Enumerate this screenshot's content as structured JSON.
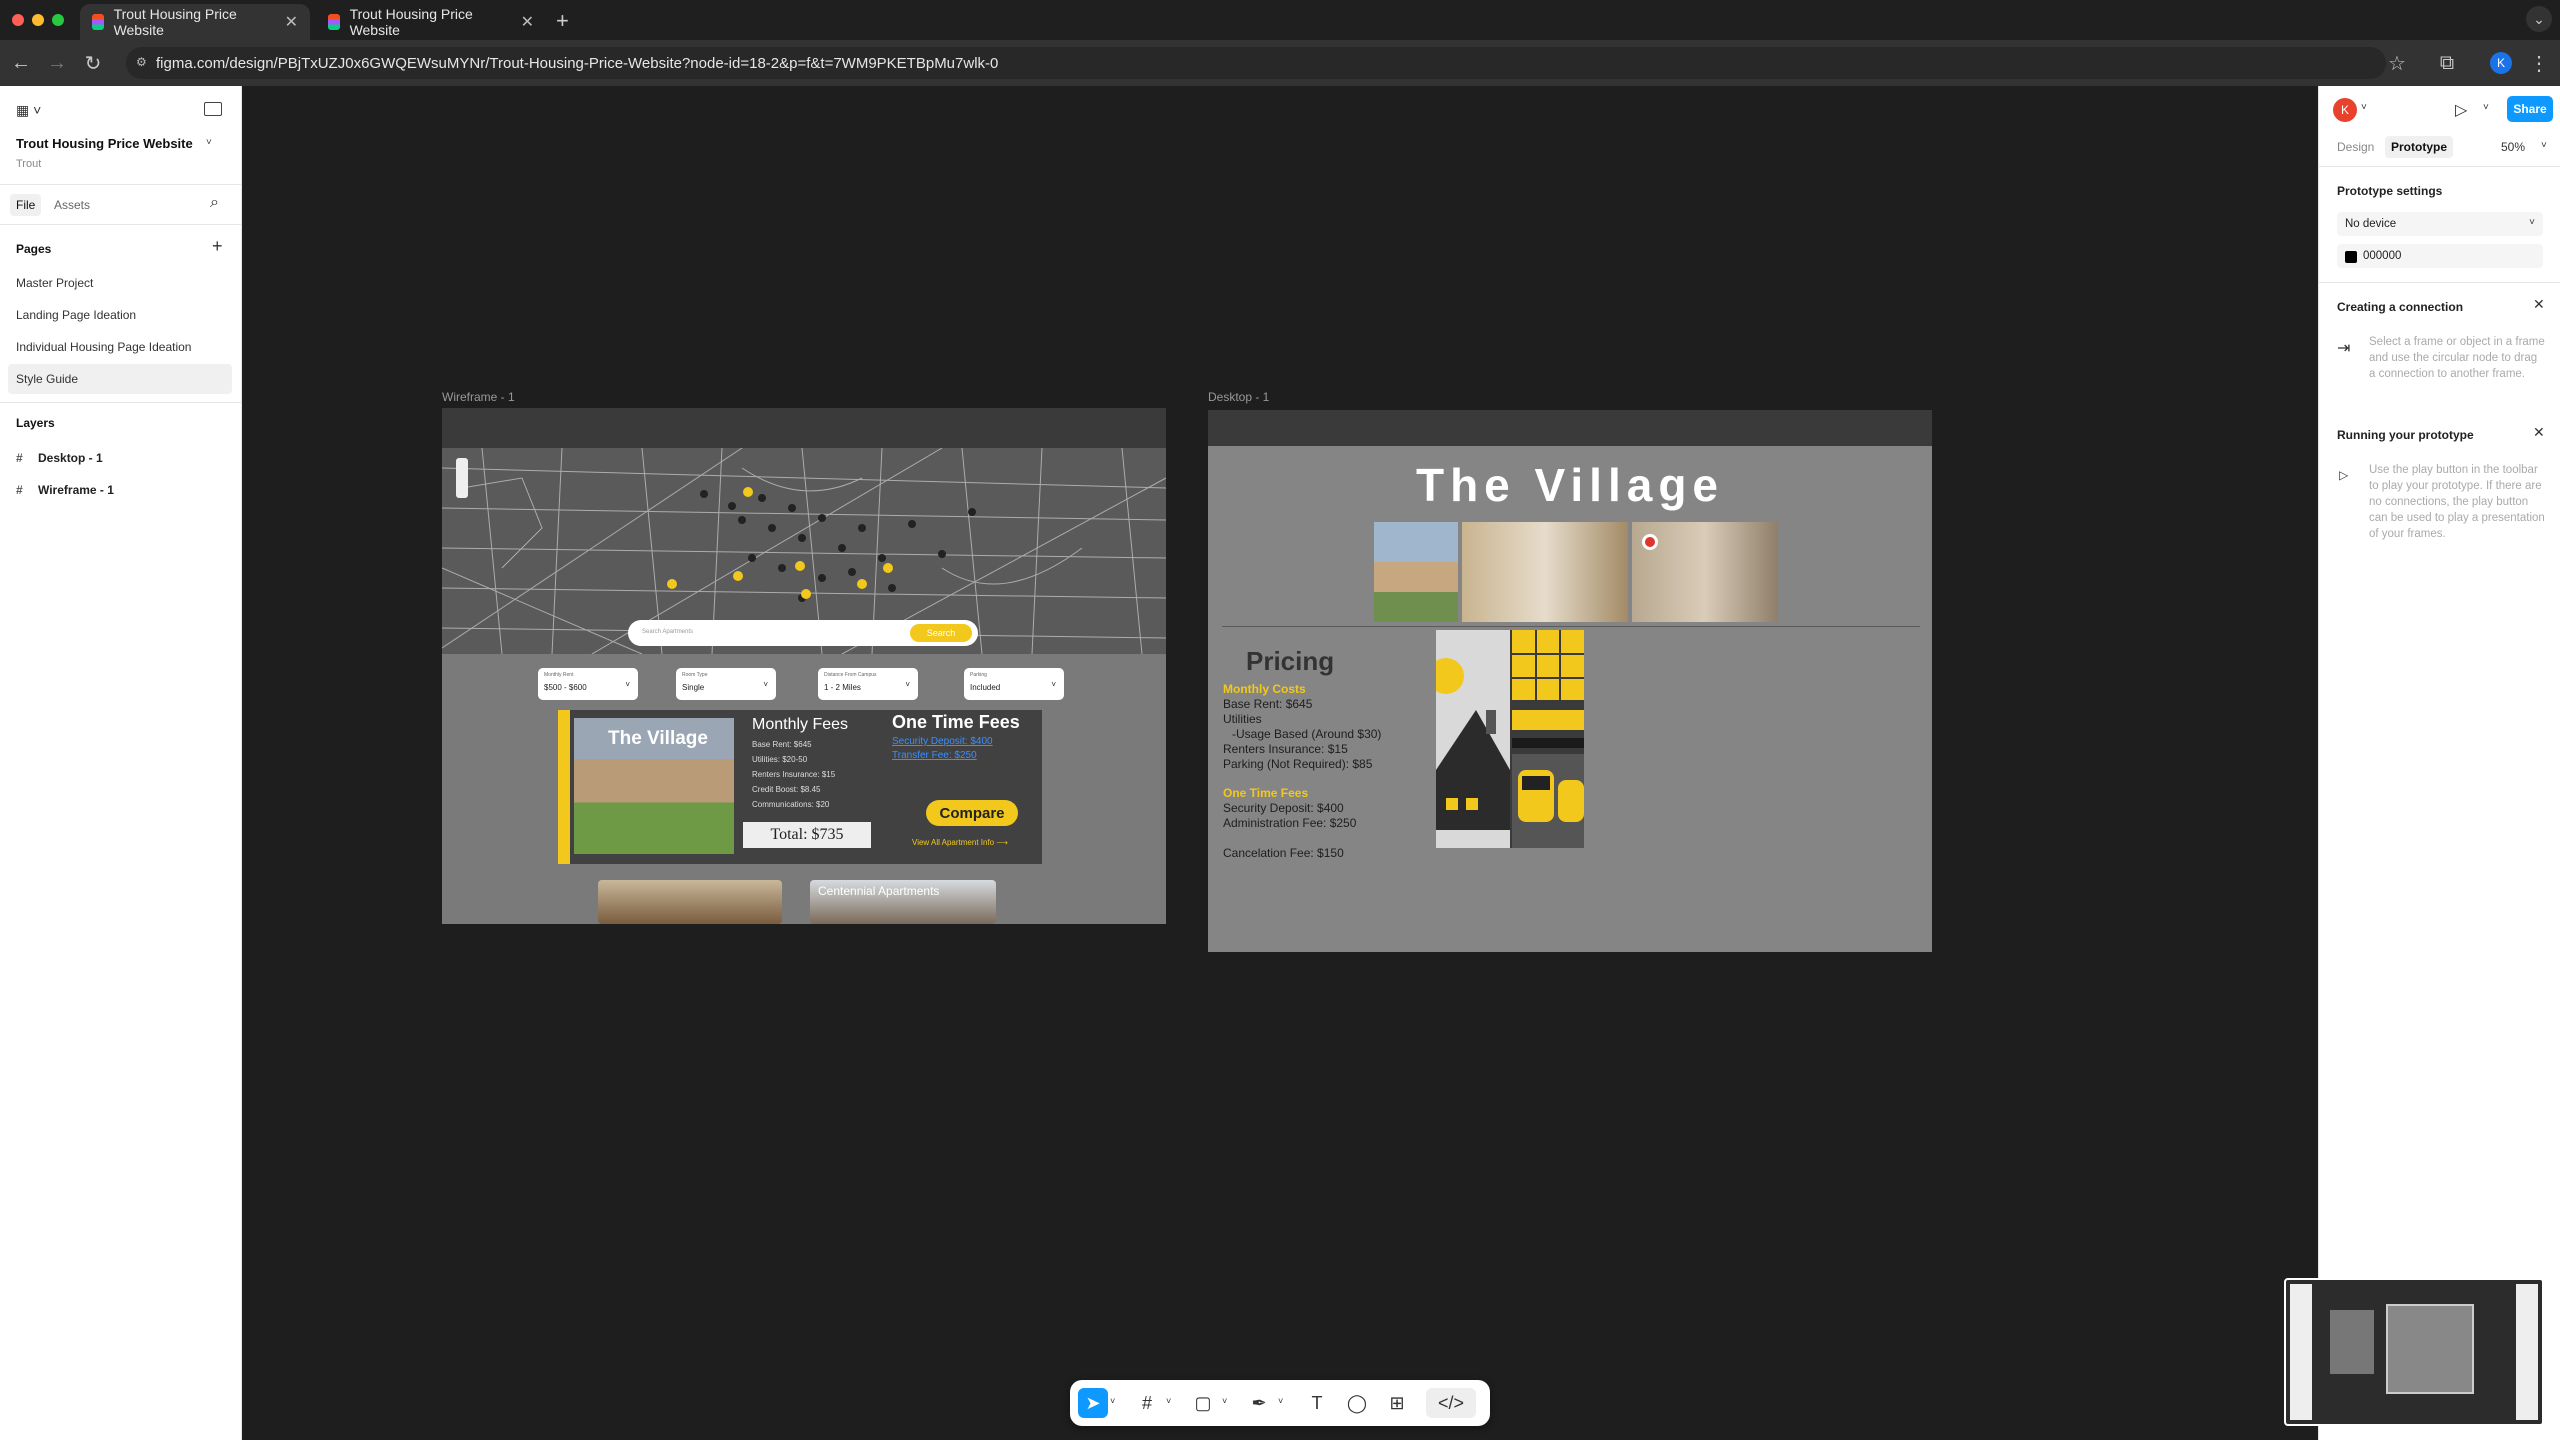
{
  "browser": {
    "tabs": [
      {
        "title": "Trout Housing Price Website",
        "active": true
      },
      {
        "title": "Trout Housing Price Website",
        "active": false
      }
    ],
    "url": "figma.com/design/PBjTxUZJ0x6GWQEWsuMYNr/Trout-Housing-Price-Website?node-id=18-2&p=f&t=7WM9PKETBpMu7wlk-0",
    "profile_initial": "K"
  },
  "left_panel": {
    "file_name": "Trout Housing Price Website",
    "team": "Trout",
    "tabs": {
      "file": "File",
      "assets": "Assets"
    },
    "pages_heading": "Pages",
    "pages": [
      "Master Project",
      "Landing Page Ideation",
      "Individual Housing Page Ideation",
      "Style Guide"
    ],
    "selected_page": "Style Guide",
    "layers_heading": "Layers",
    "layers": [
      "Desktop - 1",
      "Wireframe - 1"
    ]
  },
  "canvas": {
    "wireframe_label": "Wireframe - 1",
    "desktop_label": "Desktop - 1",
    "wireframe": {
      "search_button": "Search",
      "search_placeholder": "Search Apartments",
      "filters": [
        {
          "label": "Monthly Rent",
          "value": "$500 - $600"
        },
        {
          "label": "Room Type",
          "value": "Single"
        },
        {
          "label": "Distance From Campus",
          "value": "1 - 2 Miles"
        },
        {
          "label": "Parking",
          "value": "Included"
        }
      ],
      "card_title": "The Village",
      "monthly_heading": "Monthly Fees",
      "monthly_items": [
        "Base Rent: $645",
        "Utilities: $20-50",
        "Renters Insurance: $15",
        "Credit Boost: $8.45",
        "Communications: $20"
      ],
      "onetime_heading": "One Time Fees",
      "onetime_items": [
        "Security Deposit: $400",
        "Transfer Fee: $250"
      ],
      "total": "Total: $735",
      "compare": "Compare",
      "view_all": "View All Apartment Info ⟶",
      "second_card": "Centennial Apartments"
    },
    "desktop": {
      "title": "The Village",
      "pricing_heading": "Pricing",
      "monthly_heading": "Monthly Costs",
      "monthly_items": [
        "Base Rent: $645",
        "Utilities",
        "  -Usage Based (Around $30)",
        "Renters Insurance: $15",
        "Parking (Not Required): $85"
      ],
      "onetime_heading": "One Time Fees",
      "onetime_items": [
        "Security Deposit: $400",
        "Administration Fee: $250"
      ],
      "cancel": "Cancelation Fee: $150"
    }
  },
  "right_panel": {
    "avatar": "K",
    "share": "Share",
    "tabs": {
      "design": "Design",
      "prototype": "Prototype"
    },
    "zoom": "50%",
    "prototype_settings": "Prototype settings",
    "device": "No device",
    "bg_color": "000000",
    "connection_title": "Creating a connection",
    "connection_desc": "Select a frame or object in a frame and use the circular node to drag a connection to another frame.",
    "running_title": "Running your prototype",
    "running_desc": "Use the play button in the toolbar to play your prototype. If there are no connections, the play button can be used to play a presentation of your frames."
  },
  "colors": {
    "accent": "#0d99ff",
    "yellow": "#f2c81c"
  }
}
